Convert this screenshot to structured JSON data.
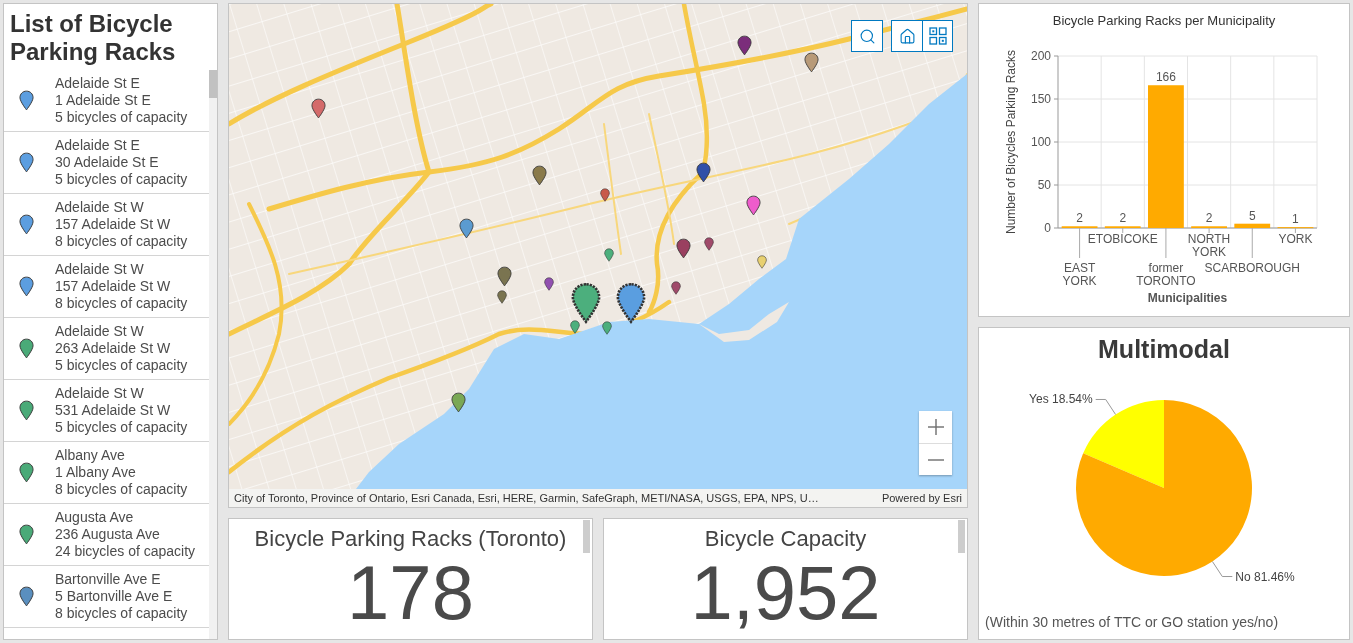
{
  "list_panel": {
    "title": "List of Bicycle Parking Racks",
    "items": [
      {
        "street": "Adelaide St E",
        "address": "1 Adelaide St E",
        "capacity": "5 bicycles of capacity",
        "color": "#5c9ee0"
      },
      {
        "street": "Adelaide St E",
        "address": "30 Adelaide St E",
        "capacity": "5 bicycles of capacity",
        "color": "#5c9ee0"
      },
      {
        "street": "Adelaide St W",
        "address": "157 Adelaide St W",
        "capacity": "8 bicycles of capacity",
        "color": "#5c9ee0"
      },
      {
        "street": "Adelaide St W",
        "address": "157 Adelaide St W",
        "capacity": "8 bicycles of capacity",
        "color": "#5c9ee0"
      },
      {
        "street": "Adelaide St W",
        "address": "263 Adelaide St W",
        "capacity": "5 bicycles of capacity",
        "color": "#4aaa78"
      },
      {
        "street": "Adelaide St W",
        "address": "531 Adelaide St W",
        "capacity": "5 bicycles of capacity",
        "color": "#4aaa78"
      },
      {
        "street": "Albany Ave",
        "address": "1 Albany Ave",
        "capacity": "8 bicycles of capacity",
        "color": "#4aaa78"
      },
      {
        "street": "Augusta Ave",
        "address": "236 Augusta Ave",
        "capacity": "24 bicycles of capacity",
        "color": "#4aaa78"
      },
      {
        "street": "Bartonville Ave E",
        "address": "5 Bartonville Ave E",
        "capacity": "8 bicycles of capacity",
        "color": "#5a8fbf"
      }
    ]
  },
  "map": {
    "attribution": "City of Toronto, Province of Ontario, Esri Canada, Esri, HERE, Garmin, SafeGraph, METI/NASA, USGS, EPA, NPS, U…",
    "credit": "Powered by Esri"
  },
  "indicators": [
    {
      "title": "Bicycle Parking Racks (Toronto)",
      "value": "178"
    },
    {
      "title": "Bicycle Capacity",
      "value": "1,952"
    }
  ],
  "bar_chart_panel": {
    "chart_data": {
      "type": "bar",
      "title": "Bicycle Parking Racks per Municipality",
      "xlabel": "Municipalities",
      "ylabel": "Number of Bicycles Parking Racks",
      "categories": [
        "EAST YORK",
        "ETOBICOKE",
        "former TORONTO",
        "NORTH YORK",
        "SCARBOROUGH",
        "YORK"
      ],
      "series": [
        {
          "color": "#ffaa00",
          "values": [
            2,
            2,
            166,
            2,
            5,
            1
          ]
        }
      ],
      "ylim": [
        0,
        200
      ],
      "yticks": [
        0,
        50,
        100,
        150,
        200
      ],
      "grid": true,
      "data_labels": true
    }
  },
  "pie_panel": {
    "title": "Multimodal",
    "chart_data": {
      "type": "pie",
      "categories": [
        "Yes",
        "No"
      ],
      "values": [
        18.54,
        81.46
      ],
      "value_labels": [
        "18.54%",
        "81.46%"
      ]
    },
    "note": "(Within 30 metres of TTC or GO station yes/no)"
  }
}
